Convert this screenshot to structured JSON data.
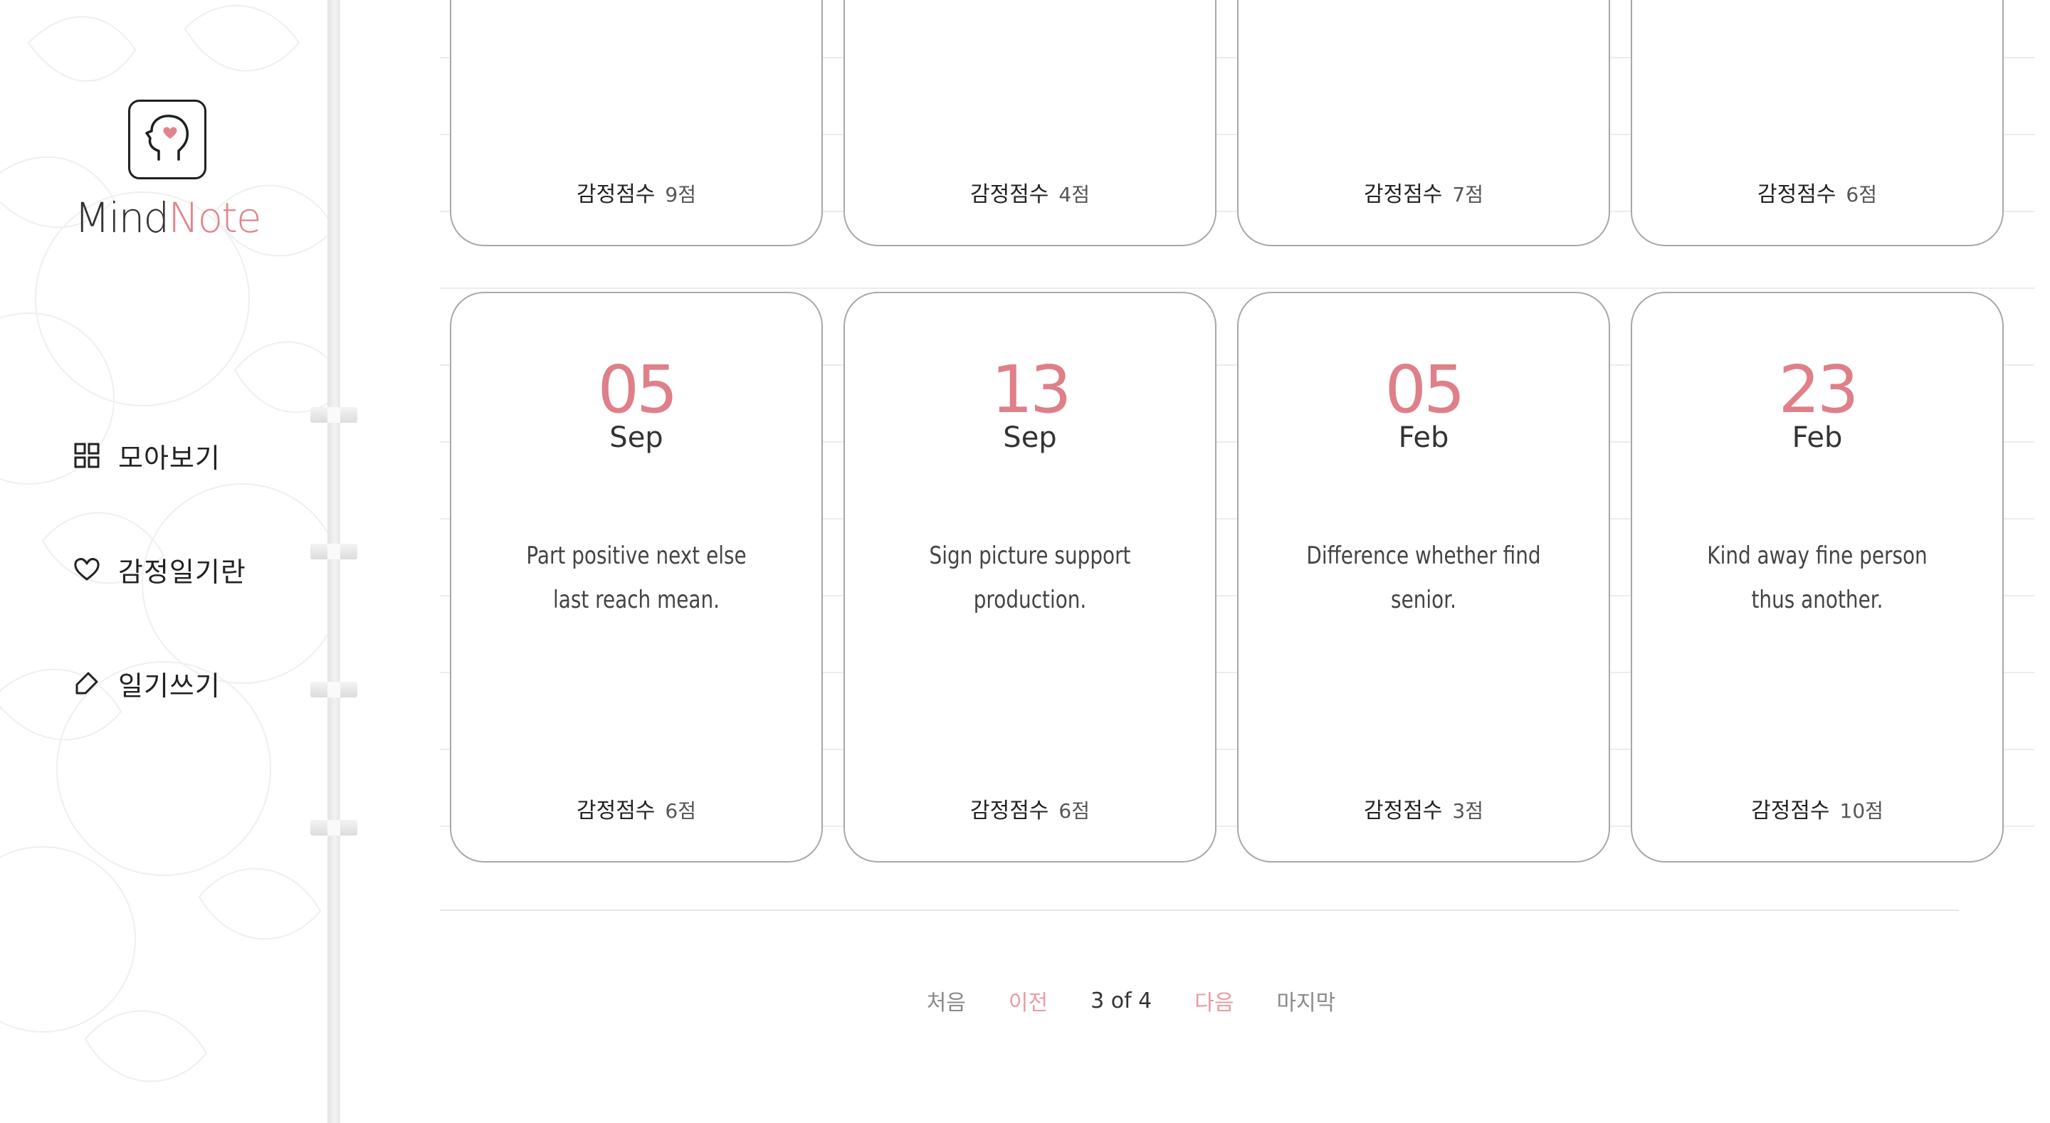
{
  "brand": {
    "mind": "Mind",
    "note": "Note"
  },
  "colors": {
    "accent": "#df7f88",
    "accent_light": "#ec9aa2",
    "card_border": "#a8a8a8"
  },
  "nav": {
    "items": [
      {
        "label": "모아보기",
        "icon": "grid-icon"
      },
      {
        "label": "감정일기란",
        "icon": "heart-icon"
      },
      {
        "label": "일기쓰기",
        "icon": "pencil-icon"
      }
    ]
  },
  "score_label": "감정점수",
  "top_cards": [
    {
      "score": "9점"
    },
    {
      "score": "4점"
    },
    {
      "score": "7점"
    },
    {
      "score": "6점"
    }
  ],
  "cards": [
    {
      "day": "05",
      "month": "Sep",
      "body": "Part positive next else last reach mean.",
      "score": "6점"
    },
    {
      "day": "13",
      "month": "Sep",
      "body": "Sign picture support production.",
      "score": "6점"
    },
    {
      "day": "05",
      "month": "Feb",
      "body": "Difference whether find senior.",
      "score": "3점"
    },
    {
      "day": "23",
      "month": "Feb",
      "body": "Kind away fine person thus another.",
      "score": "10점"
    }
  ],
  "pagination": {
    "first": "처음",
    "prev": "이전",
    "info": "3 of 4",
    "next": "다음",
    "last": "마지막"
  }
}
